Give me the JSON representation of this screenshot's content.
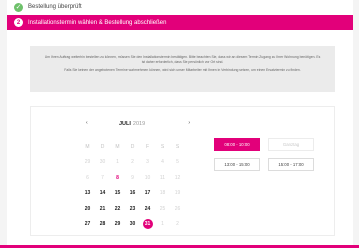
{
  "previous_step": {
    "label": "Bestellung überprüft"
  },
  "current_step": {
    "number": "2",
    "title": "Installationstermin wählen & Bestellung abschließen"
  },
  "info": {
    "paragraph_1": "Um Ihren Auftrag weiterhin bestellen zu können, müssen Sie den Installationstermin bestätigen. Bitte beachten Sie, dass wir an diesem Termin Zugang zu Ihrer Wohnung benötigen. Es ist daher erforderlich, dass Sie persönlich vor Ort sind.",
    "paragraph_2": "Falls Sie keinen der angebotenen Termine wahrnehmen können, wird sich unser Mitarbeiter mit Ihnen in Verbindung setzen, um einen Ersatztermin zu finden."
  },
  "calendar": {
    "prev_label": "‹",
    "next_label": "›",
    "month": "JULI",
    "year": "2019",
    "weekdays": [
      "M",
      "D",
      "M",
      "D",
      "F",
      "S",
      "S"
    ],
    "weeks": [
      [
        "29",
        "30",
        "1",
        "2",
        "3",
        "4",
        "5"
      ],
      [
        "6",
        "7",
        "8",
        "9",
        "10",
        "11",
        "12"
      ],
      [
        "13",
        "14",
        "15",
        "16",
        "17",
        "18",
        "19"
      ],
      [
        "20",
        "21",
        "22",
        "23",
        "24",
        "25",
        "26"
      ],
      [
        "27",
        "28",
        "29",
        "30",
        "31",
        "1",
        "2"
      ]
    ]
  },
  "time_slots": {
    "slot_1": "08:00 - 10:00",
    "slot_2": "Ganztag",
    "slot_3": "13:00 - 15:00",
    "slot_4": "15:00 - 17:00"
  },
  "colors": {
    "accent": "#e2007a",
    "success": "#6ec16b"
  }
}
